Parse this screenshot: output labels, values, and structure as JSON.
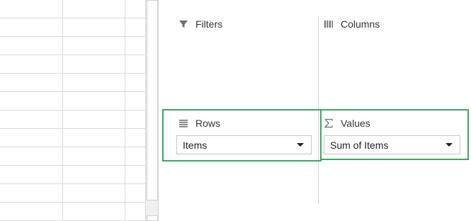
{
  "pivot_fields": {
    "filters": {
      "label": "Filters",
      "icon": "filter-icon"
    },
    "columns": {
      "label": "Columns",
      "icon": "columns-icon"
    },
    "rows": {
      "label": "Rows",
      "icon": "rows-icon",
      "field": "Items"
    },
    "values": {
      "label": "Values",
      "icon": "sigma-icon",
      "field": "Sum of Items"
    }
  },
  "colors": {
    "highlight": "#3aa864",
    "grid": "#dadada"
  }
}
